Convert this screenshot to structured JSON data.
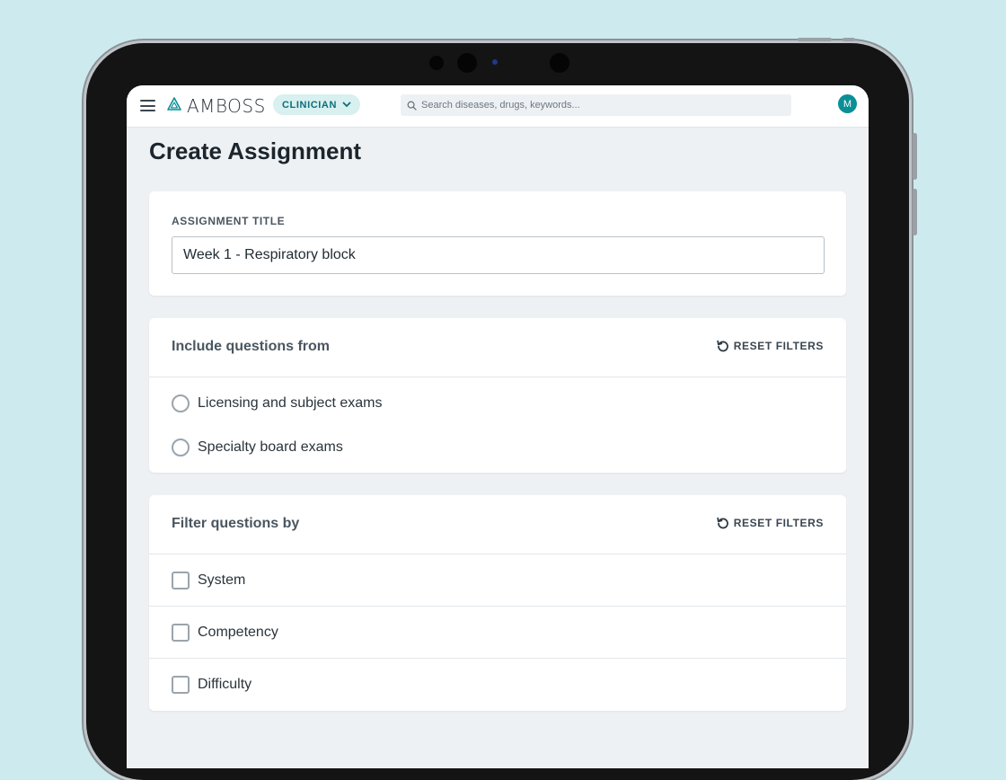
{
  "app": {
    "brand": "AMBOSS",
    "role": "CLINICIAN",
    "search_placeholder": "Search diseases, drugs, keywords...",
    "avatar_initial": "M",
    "accent_color": "#0a8f96"
  },
  "page": {
    "title": "Create Assignment"
  },
  "assignment": {
    "label": "ASSIGNMENT TITLE",
    "value": "Week 1 - Respiratory block"
  },
  "include": {
    "heading": "Include questions from",
    "reset_label": "RESET FILTERS",
    "options": [
      {
        "label": "Licensing and subject exams",
        "selected": false
      },
      {
        "label": "Specialty board exams",
        "selected": false
      }
    ]
  },
  "filter": {
    "heading": "Filter questions by",
    "reset_label": "RESET FILTERS",
    "options": [
      {
        "label": "System",
        "checked": false
      },
      {
        "label": "Competency",
        "checked": false
      },
      {
        "label": "Difficulty",
        "checked": false
      }
    ]
  }
}
